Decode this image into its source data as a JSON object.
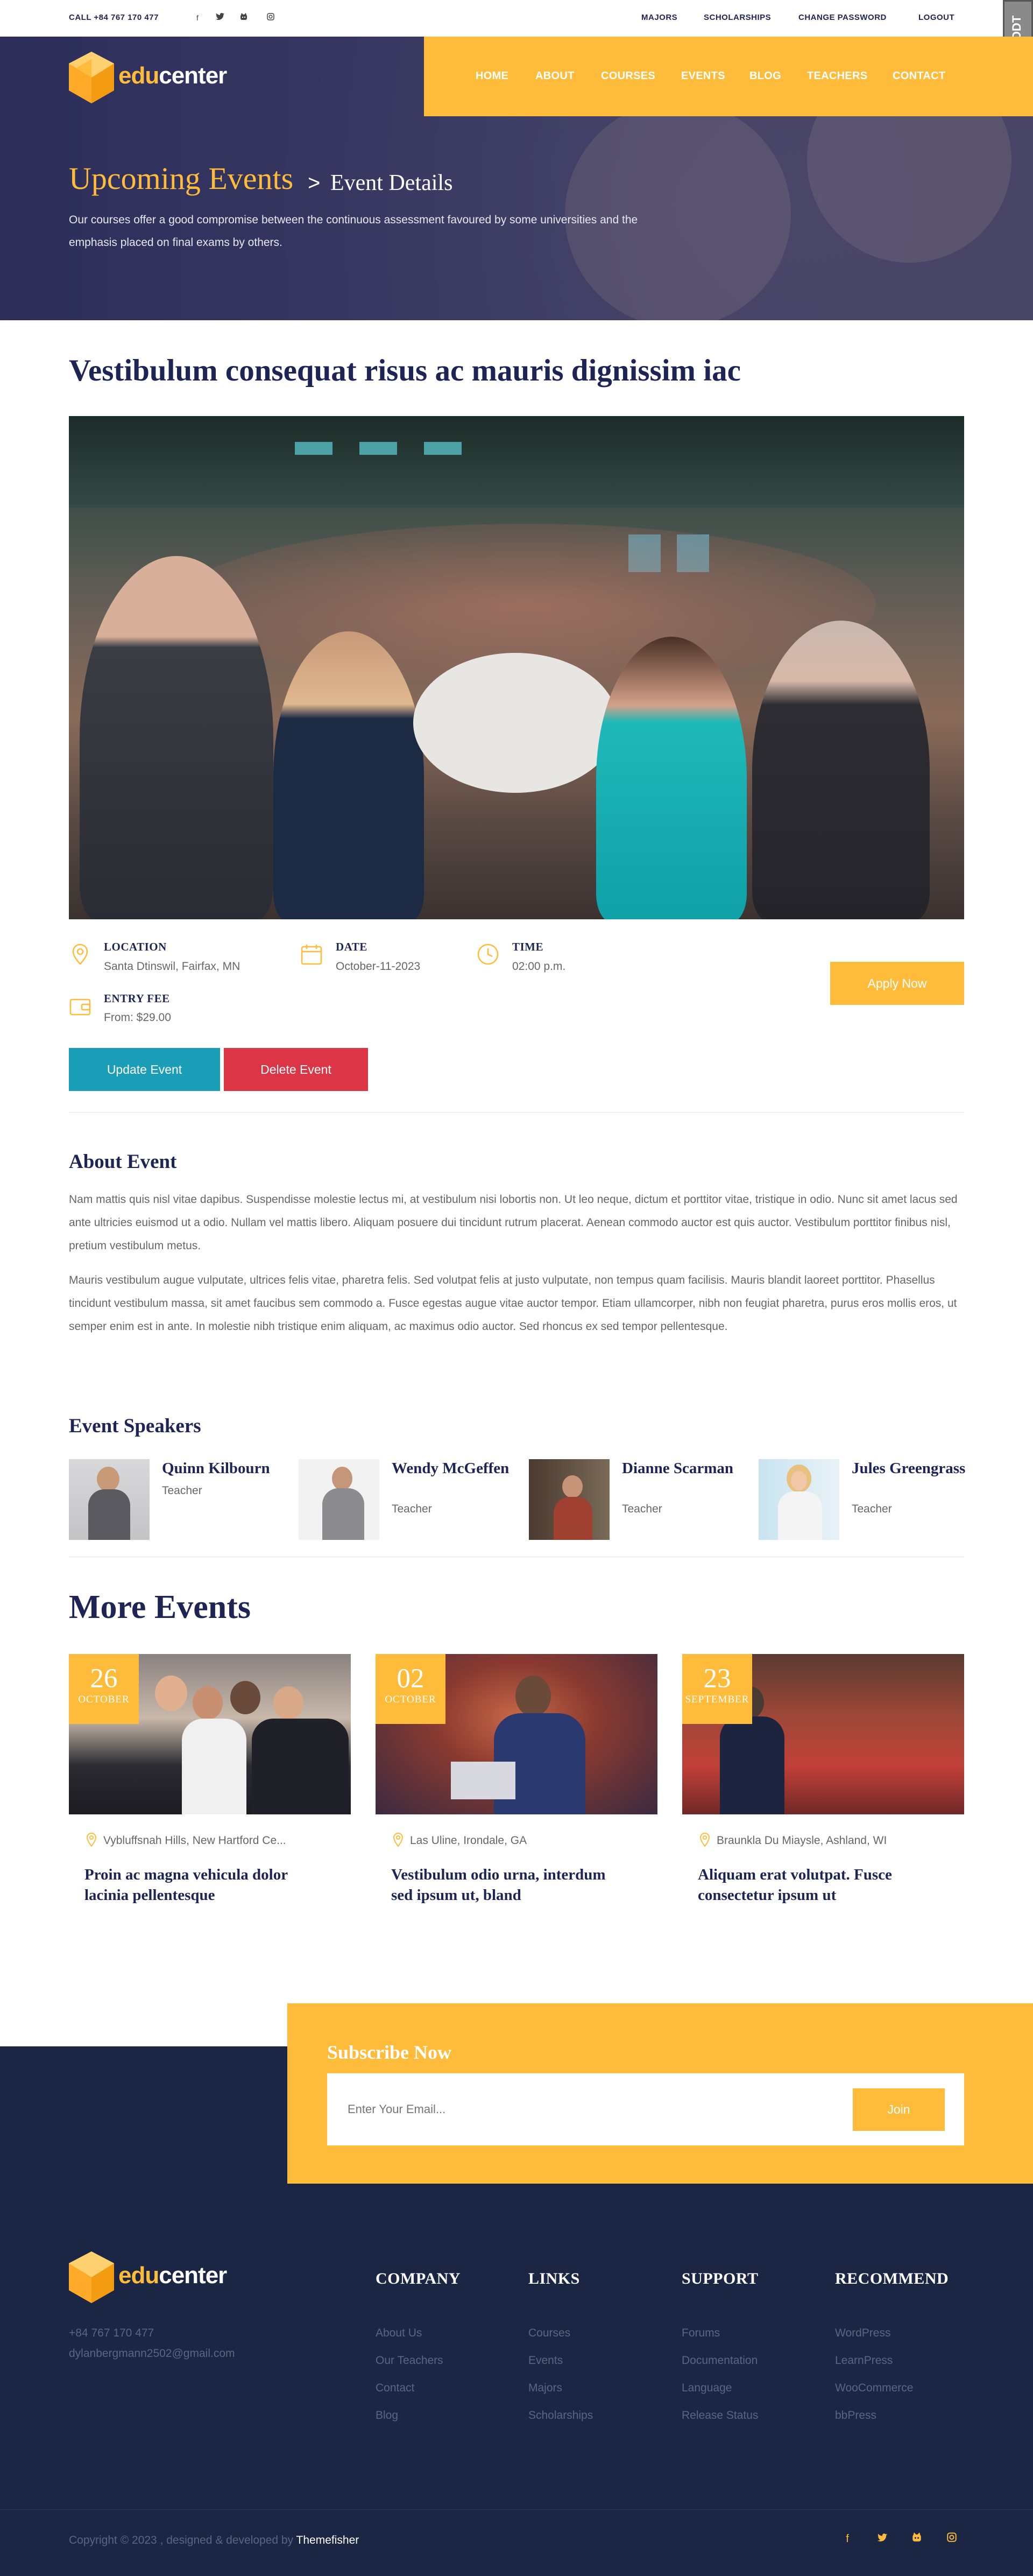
{
  "topbar": {
    "call": "CALL +84 767 170 477",
    "links": [
      "MAJORS",
      "SCHOLARSHIPS",
      "CHANGE PASSWORD",
      "LOGOUT"
    ],
    "badge": "DDT"
  },
  "brand": {
    "name_a": "edu",
    "name_b": "center"
  },
  "nav": [
    "HOME",
    "ABOUT",
    "COURSES",
    "EVENTS",
    "BLOG",
    "TEACHERS",
    "CONTACT"
  ],
  "hero": {
    "crumb_parent": "Upcoming Events",
    "crumb_sep": ">",
    "crumb_current": "Event Details",
    "desc": "Our courses offer a good compromise between the continuous assessment favoured by some universities and the emphasis placed on final exams by others."
  },
  "event": {
    "title": "Vestibulum consequat risus ac mauris dignissim iac",
    "location_label": "LOCATION",
    "location_value": "Santa Dtinswil, Fairfax, MN",
    "date_label": "DATE",
    "date_value": "October-11-2023",
    "time_label": "TIME",
    "time_value": "02:00 p.m.",
    "fee_label": "ENTRY FEE",
    "fee_value": "From: $29.00",
    "apply": "Apply Now",
    "update": "Update Event",
    "delete": "Delete Event"
  },
  "about": {
    "heading": "About Event",
    "p1": "Nam mattis quis nisl vitae dapibus. Suspendisse molestie lectus mi, at vestibulum nisi lobortis non. Ut leo neque, dictum et porttitor vitae, tristique in odio. Nunc sit amet lacus sed ante ultricies euismod ut a odio. Nullam vel mattis libero. Aliquam posuere dui tincidunt rutrum placerat. Aenean commodo auctor est quis auctor. Vestibulum porttitor finibus nisl, pretium vestibulum metus.",
    "p2": "Mauris vestibulum augue vulputate, ultrices felis vitae, pharetra felis. Sed volutpat felis at justo vulputate, non tempus quam facilisis. Mauris blandit laoreet porttitor. Phasellus tincidunt vestibulum massa, sit amet faucibus sem commodo a. Fusce egestas augue vitae auctor tempor. Etiam ullamcorper, nibh non feugiat pharetra, purus eros mollis eros, ut semper enim est in ante. In molestie nibh tristique enim aliquam, ac maximus odio auctor. Sed rhoncus ex sed tempor pellentesque."
  },
  "speakers": {
    "heading": "Event Speakers",
    "items": [
      {
        "name": "Quinn Kilbourn",
        "role": "Teacher"
      },
      {
        "name": "Wendy McGeffen",
        "role": "Teacher"
      },
      {
        "name": "Dianne Scarman",
        "role": "Teacher"
      },
      {
        "name": "Jules Greengrass",
        "role": "Teacher"
      }
    ]
  },
  "more": {
    "heading": "More Events",
    "cards": [
      {
        "day": "26",
        "month": "OCTOBER",
        "location": "Vybluffsnah Hills, New Hartford Ce...",
        "title": "Proin ac magna vehicula dolor lacinia pellentesque"
      },
      {
        "day": "02",
        "month": "OCTOBER",
        "location": "Las Uline, Irondale, GA",
        "title": "Vestibulum odio urna, interdum sed ipsum ut, bland"
      },
      {
        "day": "23",
        "month": "SEPTEMBER",
        "location": "Braunkla Du Miaysle, Ashland, WI",
        "title": "Aliquam erat volutpat. Fusce consectetur ipsum ut"
      }
    ]
  },
  "subscribe": {
    "heading": "Subscribe Now",
    "placeholder": "Enter Your Email...",
    "button": "Join"
  },
  "footer": {
    "phone": "+84 767 170 477",
    "email": "dylanbergmann2502@gmail.com",
    "columns": [
      {
        "heading": "COMPANY",
        "links": [
          "About Us",
          "Our Teachers",
          "Contact",
          "Blog"
        ]
      },
      {
        "heading": "LINKS",
        "links": [
          "Courses",
          "Events",
          "Majors",
          "Scholarships"
        ]
      },
      {
        "heading": "SUPPORT",
        "links": [
          "Forums",
          "Documentation",
          "Language",
          "Release Status"
        ]
      },
      {
        "heading": "RECOMMEND",
        "links": [
          "WordPress",
          "LearnPress",
          "WooCommerce",
          "bbPress"
        ]
      }
    ],
    "copyright": "Copyright © 2023 , designed & developed by ",
    "brand": "Themefisher"
  },
  "colors": {
    "accent": "#ffbc3b",
    "navy": "#1e2554",
    "footer": "#1a2643",
    "update": "#1a9eb8",
    "delete": "#dc3545"
  },
  "icons": [
    "facebook-icon",
    "twitter-icon",
    "github-icon",
    "instagram-icon",
    "map-pin-icon",
    "calendar-icon",
    "clock-icon",
    "wallet-icon"
  ]
}
